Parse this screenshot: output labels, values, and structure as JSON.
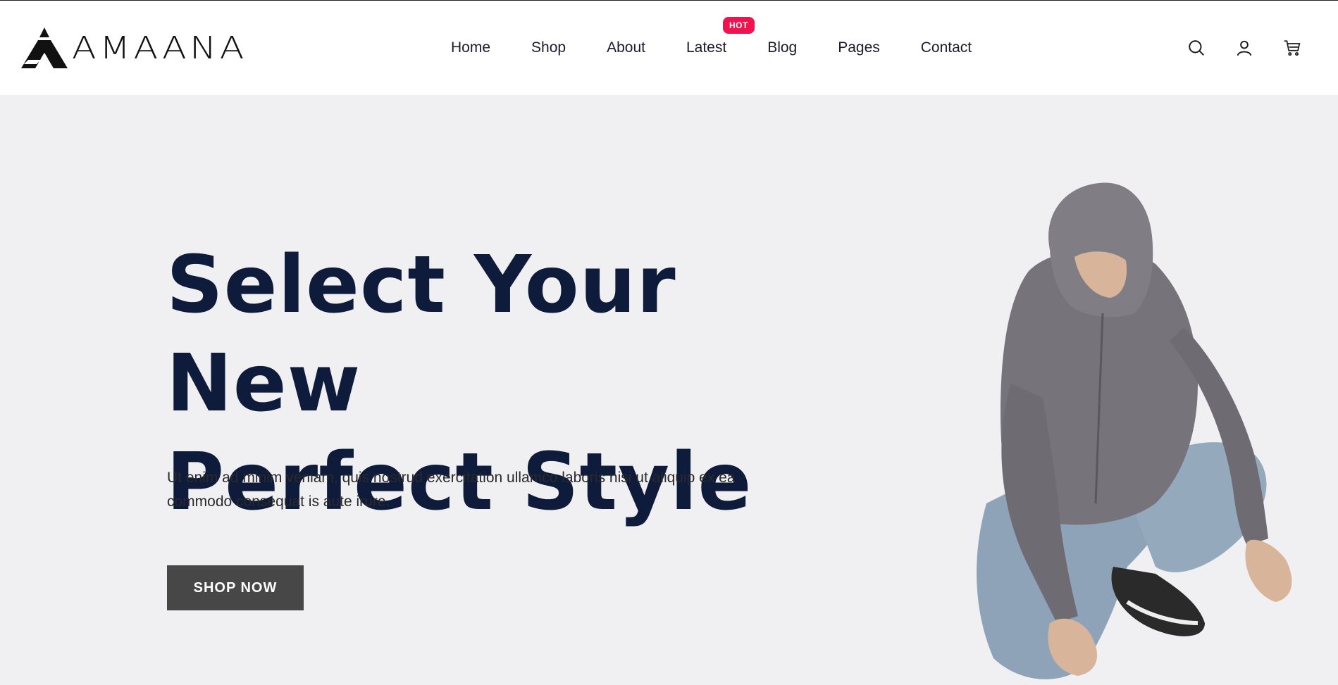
{
  "brand": {
    "name": "AMAANA"
  },
  "nav": {
    "items": [
      {
        "label": "Home"
      },
      {
        "label": "Shop"
      },
      {
        "label": "About"
      },
      {
        "label": "Latest",
        "badge": "HOT"
      },
      {
        "label": "Blog"
      },
      {
        "label": "Pages"
      },
      {
        "label": "Contact"
      }
    ]
  },
  "icons": {
    "search": "search-icon",
    "account": "user-icon",
    "cart": "cart-icon"
  },
  "hero": {
    "title_line1": "Select Your New",
    "title_line2": "Perfect Style",
    "text": "Ut enim ad minim veniam, quis nostrud exercitation ullamco laboris nisi ut aliquip ex ea commodo consequat is aute irure.",
    "button": "SHOP NOW"
  },
  "colors": {
    "badge": "#f0134d",
    "title": "#0f1b3a",
    "button": "#474747",
    "hero_bg": "#f0f0f3"
  }
}
